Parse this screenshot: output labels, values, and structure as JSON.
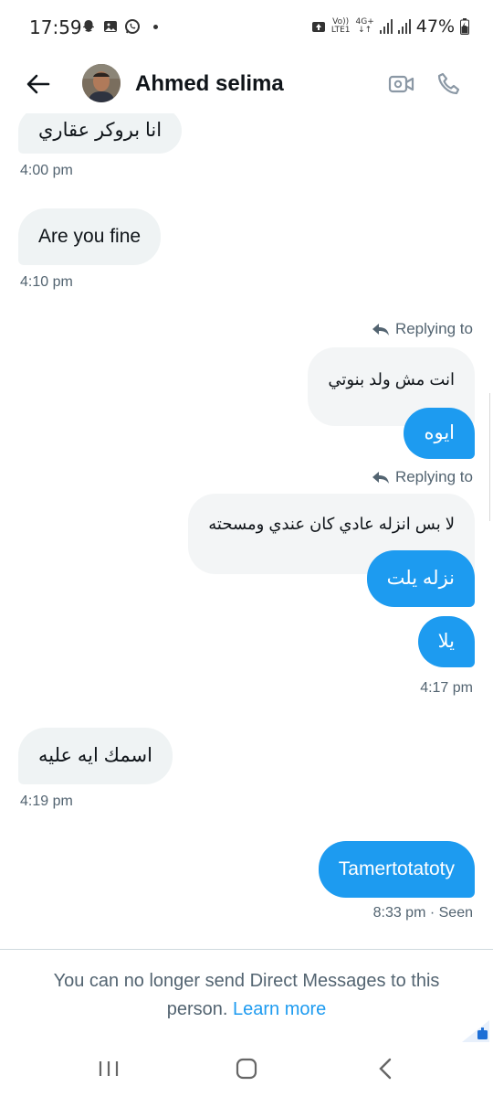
{
  "status_bar": {
    "time": "17:59",
    "network_top": "Vo))",
    "network_bottom": "LTE1",
    "network_type": "4G+",
    "battery": "47%"
  },
  "header": {
    "contact_name": "Ahmed selima",
    "back_icon": "arrow-left-icon",
    "video_icon": "video-camera-icon",
    "call_icon": "phone-icon"
  },
  "messages": [
    {
      "dir": "in",
      "text": "انا بروكر عقاري",
      "time": "4:00 pm"
    },
    {
      "dir": "in",
      "text": "Are you fine",
      "time": "4:10 pm"
    },
    {
      "dir": "out",
      "reply_label": "Replying to",
      "quoted": "انت مش ولد بنوتي",
      "text": "ايوه"
    },
    {
      "dir": "out",
      "reply_label": "Replying to",
      "quoted": "لا بس انزله عادي كان عندي ومسحته",
      "text": "نزله يلت"
    },
    {
      "dir": "out",
      "text": "يلا",
      "time": "4:17 pm"
    },
    {
      "dir": "in",
      "text": "اسمك ايه عليه",
      "time": "4:19 pm"
    },
    {
      "dir": "out",
      "text": "Tamertotatoty",
      "time": "8:33 pm · Seen"
    }
  ],
  "footer": {
    "notice": "You can no longer send Direct Messages to this person.",
    "learn_more": "Learn more"
  },
  "colors": {
    "accent": "#1d9bf0",
    "incoming_bubble": "#eff3f4",
    "muted_text": "#536471"
  }
}
